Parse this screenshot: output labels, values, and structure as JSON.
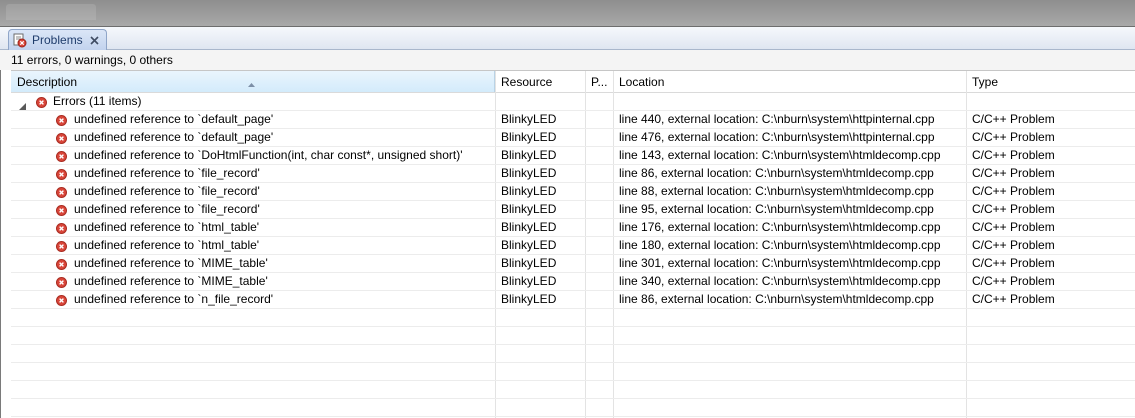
{
  "view": {
    "tab_label": "Problems",
    "summary": "11 errors, 0 warnings, 0 others"
  },
  "columns": {
    "description": "Description",
    "resource": "Resource",
    "path": "P...",
    "location": "Location",
    "type": "Type"
  },
  "group": {
    "label": "Errors (11 items)"
  },
  "problems": [
    {
      "description": "undefined reference to `default_page'",
      "resource": "BlinkyLED",
      "path": "",
      "location": "line 440, external location: C:\\nburn\\system\\httpinternal.cpp",
      "type": "C/C++ Problem"
    },
    {
      "description": "undefined reference to `default_page'",
      "resource": "BlinkyLED",
      "path": "",
      "location": "line 476, external location: C:\\nburn\\system\\httpinternal.cpp",
      "type": "C/C++ Problem"
    },
    {
      "description": "undefined reference to `DoHtmlFunction(int, char const*, unsigned short)'",
      "resource": "BlinkyLED",
      "path": "",
      "location": "line 143, external location: C:\\nburn\\system\\htmldecomp.cpp",
      "type": "C/C++ Problem"
    },
    {
      "description": "undefined reference to `file_record'",
      "resource": "BlinkyLED",
      "path": "",
      "location": "line 86, external location: C:\\nburn\\system\\htmldecomp.cpp",
      "type": "C/C++ Problem"
    },
    {
      "description": "undefined reference to `file_record'",
      "resource": "BlinkyLED",
      "path": "",
      "location": "line 88, external location: C:\\nburn\\system\\htmldecomp.cpp",
      "type": "C/C++ Problem"
    },
    {
      "description": "undefined reference to `file_record'",
      "resource": "BlinkyLED",
      "path": "",
      "location": "line 95, external location: C:\\nburn\\system\\htmldecomp.cpp",
      "type": "C/C++ Problem"
    },
    {
      "description": "undefined reference to `html_table'",
      "resource": "BlinkyLED",
      "path": "",
      "location": "line 176, external location: C:\\nburn\\system\\htmldecomp.cpp",
      "type": "C/C++ Problem"
    },
    {
      "description": "undefined reference to `html_table'",
      "resource": "BlinkyLED",
      "path": "",
      "location": "line 180, external location: C:\\nburn\\system\\htmldecomp.cpp",
      "type": "C/C++ Problem"
    },
    {
      "description": "undefined reference to `MIME_table'",
      "resource": "BlinkyLED",
      "path": "",
      "location": "line 301, external location: C:\\nburn\\system\\htmldecomp.cpp",
      "type": "C/C++ Problem"
    },
    {
      "description": "undefined reference to `MIME_table'",
      "resource": "BlinkyLED",
      "path": "",
      "location": "line 340, external location: C:\\nburn\\system\\htmldecomp.cpp",
      "type": "C/C++ Problem"
    },
    {
      "description": "undefined reference to `n_file_record'",
      "resource": "BlinkyLED",
      "path": "",
      "location": "line 86, external location: C:\\nburn\\system\\htmldecomp.cpp",
      "type": "C/C++ Problem"
    }
  ],
  "icons": {
    "tab": "problems-view-icon",
    "close": "close-icon",
    "error": "error-icon",
    "expander": "expanded-triangle-icon",
    "sort": "sort-ascending-icon"
  },
  "colors": {
    "error_red": "#d9463a",
    "header_selected": "#d3ebfb",
    "tab_active": "#c2d3ee"
  }
}
